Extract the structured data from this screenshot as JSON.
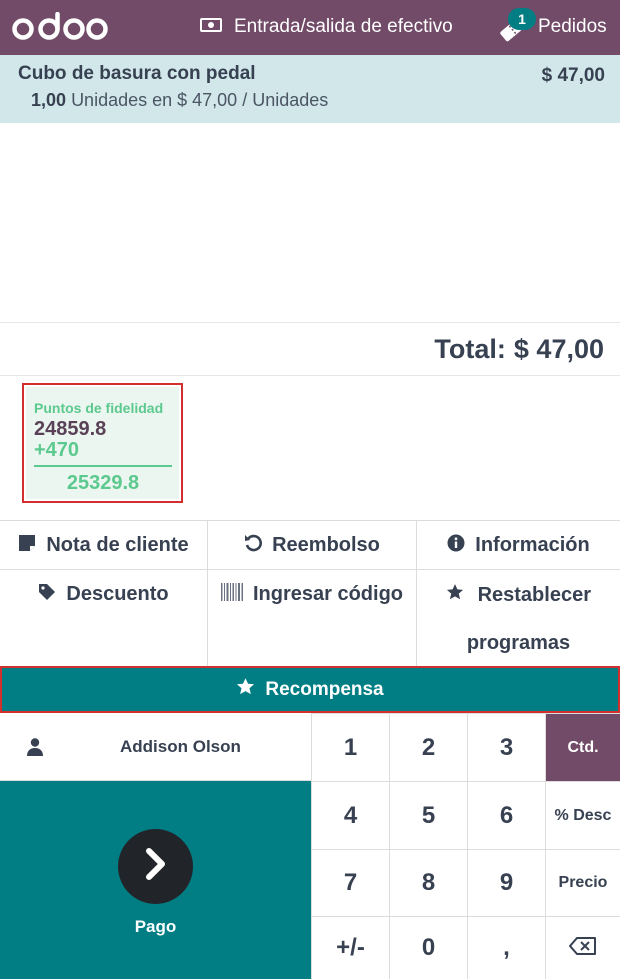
{
  "header": {
    "logo_text": "odoo",
    "cash_label": "Entrada/salida de efectivo",
    "orders_label": "Pedidos",
    "orders_count": "1"
  },
  "orderline": {
    "product": "Cubo de basura con pedal",
    "price": "$ 47,00",
    "qty": "1,00",
    "unit_detail": "Unidades en $ 47,00 / Unidades"
  },
  "total": {
    "label": "Total:",
    "amount": "$ 47,00"
  },
  "loyalty": {
    "title": "Puntos de fidelidad",
    "current": "24859.8",
    "added": "+470",
    "new_total": "25329.8"
  },
  "controls": {
    "customer_note": "Nota de cliente",
    "refund": "Reembolso",
    "info": "Información",
    "discount": "Descuento",
    "enter_code": "Ingresar código",
    "reset_programs": "Restablecer programas"
  },
  "reward": {
    "label": "Recompensa"
  },
  "customer": {
    "name": "Addison Olson"
  },
  "pay": {
    "label": "Pago"
  },
  "keypad": {
    "digits": [
      "1",
      "2",
      "3",
      "4",
      "5",
      "6",
      "7",
      "8",
      "9",
      "+/-",
      "0",
      ","
    ],
    "modes": [
      "Ctd.",
      "% Desc",
      "Precio"
    ],
    "active_mode": "Ctd."
  },
  "colors": {
    "brand": "#714b67",
    "teal": "#017e84",
    "orderline_bg": "#d1e7ea",
    "loyalty_green": "#5cc98f",
    "highlight_border": "#d32f2f"
  }
}
